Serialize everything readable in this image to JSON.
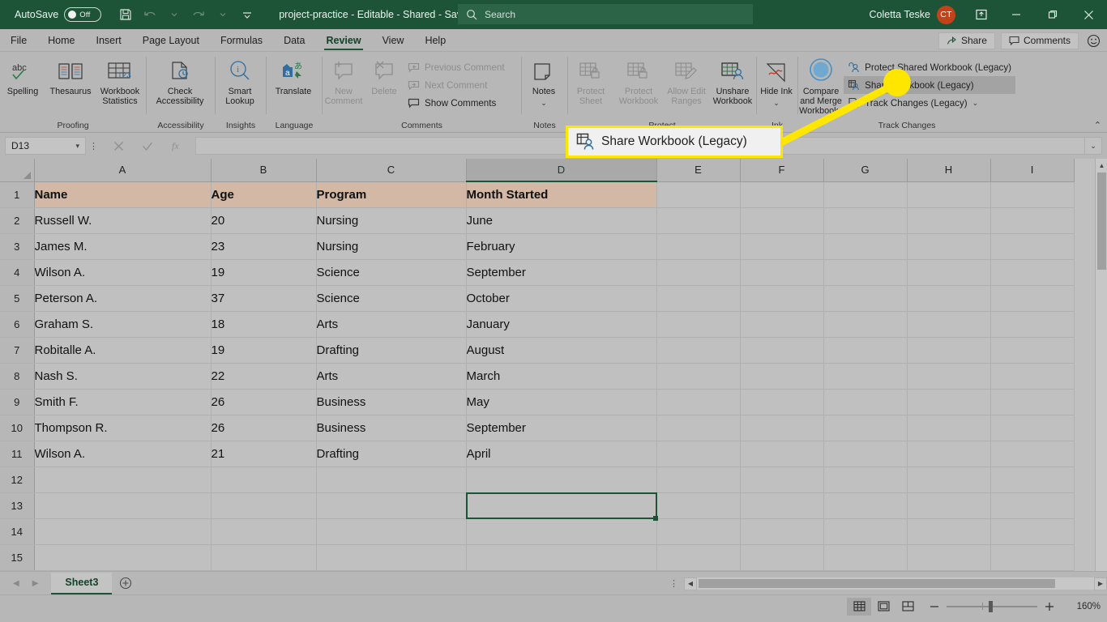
{
  "titlebar": {
    "autosave_label": "AutoSave",
    "autosave_state": "Off",
    "doc_title": "project-practice  -  Editable  -  Shared  -  Saved",
    "search_placeholder": "Search",
    "user_name": "Coletta Teske",
    "avatar_initials": "CT",
    "qat": [
      "save-icon",
      "undo-icon",
      "redo-icon",
      "customize-qat-icon"
    ],
    "window_buttons": [
      "minimize",
      "restore",
      "close"
    ]
  },
  "tabs": {
    "items": [
      {
        "label": "File",
        "active": false
      },
      {
        "label": "Home",
        "active": false
      },
      {
        "label": "Insert",
        "active": false
      },
      {
        "label": "Page Layout",
        "active": false
      },
      {
        "label": "Formulas",
        "active": false
      },
      {
        "label": "Data",
        "active": false
      },
      {
        "label": "Review",
        "active": true
      },
      {
        "label": "View",
        "active": false
      },
      {
        "label": "Help",
        "active": false
      }
    ],
    "share_label": "Share",
    "comments_label": "Comments"
  },
  "ribbon": {
    "groups": [
      {
        "label": "Proofing",
        "buttons": [
          {
            "label": "Spelling",
            "icon": "spelling-abc-check-icon",
            "disabled": false
          },
          {
            "label": "Thesaurus",
            "icon": "thesaurus-book-icon",
            "disabled": false
          },
          {
            "label": "Workbook Statistics",
            "icon": "workbook-statistics-icon",
            "disabled": false
          }
        ]
      },
      {
        "label": "Accessibility",
        "buttons": [
          {
            "label": "Check Accessibility",
            "icon": "check-accessibility-icon",
            "disabled": false
          }
        ]
      },
      {
        "label": "Insights",
        "buttons": [
          {
            "label": "Smart Lookup",
            "icon": "smart-lookup-icon",
            "disabled": false
          }
        ]
      },
      {
        "label": "Language",
        "buttons": [
          {
            "label": "Translate",
            "icon": "translate-icon",
            "disabled": false
          }
        ]
      },
      {
        "label": "Comments",
        "buttons": [
          {
            "label": "New Comment",
            "icon": "new-comment-icon",
            "disabled": true
          },
          {
            "label": "Delete",
            "icon": "delete-comment-icon",
            "disabled": true
          }
        ],
        "small_items": [
          {
            "label": "Previous Comment",
            "icon": "previous-comment-icon",
            "disabled": true
          },
          {
            "label": "Next Comment",
            "icon": "next-comment-icon",
            "disabled": true
          },
          {
            "label": "Show Comments",
            "icon": "show-comments-icon",
            "disabled": false
          }
        ]
      },
      {
        "label": "Notes",
        "buttons": [
          {
            "label": "Notes",
            "icon": "notes-icon",
            "disabled": false,
            "dropdown": true
          }
        ]
      },
      {
        "label": "Protect",
        "buttons": [
          {
            "label": "Protect Sheet",
            "icon": "protect-sheet-icon",
            "disabled": true
          },
          {
            "label": "Protect Workbook",
            "icon": "protect-workbook-icon",
            "disabled": true
          },
          {
            "label": "Allow Edit Ranges",
            "icon": "allow-edit-ranges-icon",
            "disabled": true
          },
          {
            "label": "Unshare Workbook",
            "icon": "unshare-workbook-icon",
            "disabled": false
          }
        ]
      },
      {
        "label": "Ink",
        "buttons": [
          {
            "label": "Hide Ink",
            "icon": "hide-ink-icon",
            "disabled": false,
            "dropdown": true
          }
        ]
      },
      {
        "label": "Track Changes",
        "buttons": [
          {
            "label": "Compare and Merge Workbooks",
            "icon": "compare-merge-workbooks-icon",
            "disabled": false
          }
        ],
        "small_items": [
          {
            "label": "Protect Shared Workbook (Legacy)",
            "icon": "protect-shared-workbook-icon",
            "disabled": false,
            "highlighted": false
          },
          {
            "label": "Share Workbook (Legacy)",
            "icon": "share-workbook-icon",
            "disabled": false,
            "highlighted": true
          },
          {
            "label": "Track Changes (Legacy)",
            "icon": "track-changes-icon",
            "disabled": false,
            "dropdown": true
          }
        ]
      }
    ],
    "collapse_icon": "collapse-ribbon-icon"
  },
  "callout": {
    "text": "Share Workbook (Legacy)",
    "icon": "share-workbook-icon",
    "border_color": "#ffe600",
    "highlight_color": "#ffe600"
  },
  "formulabar": {
    "namebox_value": "D13",
    "cancel_icon": "cancel-icon",
    "enter_icon": "enter-check-icon",
    "function_icon": "insert-function-fx-icon",
    "formula_value": ""
  },
  "grid": {
    "columns": [
      "A",
      "B",
      "C",
      "D",
      "E",
      "F",
      "G",
      "H",
      "I"
    ],
    "selected_column": "D",
    "selected_cell": "D13",
    "rows": [
      {
        "num": "1",
        "cells": [
          "Name",
          "Age",
          "Program",
          "Month Started",
          "",
          "",
          "",
          "",
          ""
        ],
        "header": true
      },
      {
        "num": "2",
        "cells": [
          "Russell W.",
          "20",
          "Nursing",
          "June",
          "",
          "",
          "",
          "",
          ""
        ]
      },
      {
        "num": "3",
        "cells": [
          "James M.",
          "23",
          "Nursing",
          "February",
          "",
          "",
          "",
          "",
          ""
        ]
      },
      {
        "num": "4",
        "cells": [
          "Wilson A.",
          "19",
          "Science",
          "September",
          "",
          "",
          "",
          "",
          ""
        ]
      },
      {
        "num": "5",
        "cells": [
          "Peterson A.",
          "37",
          "Science",
          "October",
          "",
          "",
          "",
          "",
          ""
        ]
      },
      {
        "num": "6",
        "cells": [
          "Graham S.",
          "18",
          "Arts",
          "January",
          "",
          "",
          "",
          "",
          ""
        ]
      },
      {
        "num": "7",
        "cells": [
          "Robitalle A.",
          "19",
          "Drafting",
          "August",
          "",
          "",
          "",
          "",
          ""
        ]
      },
      {
        "num": "8",
        "cells": [
          "Nash S.",
          "22",
          "Arts",
          "March",
          "",
          "",
          "",
          "",
          ""
        ]
      },
      {
        "num": "9",
        "cells": [
          "Smith F.",
          "26",
          "Business",
          "May",
          "",
          "",
          "",
          "",
          ""
        ]
      },
      {
        "num": "10",
        "cells": [
          "Thompson R.",
          "26",
          "Business",
          "September",
          "",
          "",
          "",
          "",
          ""
        ]
      },
      {
        "num": "11",
        "cells": [
          "Wilson A.",
          "21",
          "Drafting",
          "April",
          "",
          "",
          "",
          "",
          ""
        ]
      },
      {
        "num": "12",
        "cells": [
          "",
          "",
          "",
          "",
          "",
          "",
          "",
          "",
          ""
        ]
      },
      {
        "num": "13",
        "cells": [
          "",
          "",
          "",
          "",
          "",
          "",
          "",
          "",
          ""
        ]
      },
      {
        "num": "14",
        "cells": [
          "",
          "",
          "",
          "",
          "",
          "",
          "",
          "",
          ""
        ]
      },
      {
        "num": "15",
        "cells": [
          "",
          "",
          "",
          "",
          "",
          "",
          "",
          "",
          ""
        ]
      }
    ],
    "header_fill": "#d3b9a5"
  },
  "sheetbar": {
    "sheets": [
      {
        "label": "Sheet3",
        "active": true
      }
    ],
    "add_sheet_icon": "add-sheet-plus-icon"
  },
  "statusbar": {
    "view_buttons": [
      {
        "icon": "normal-view-icon",
        "active": true
      },
      {
        "icon": "page-layout-view-icon",
        "active": false
      },
      {
        "icon": "page-break-preview-icon",
        "active": false
      }
    ],
    "zoom_out_icon": "zoom-out-minus-icon",
    "zoom_in_icon": "zoom-in-plus-icon",
    "zoom_level": "160%"
  }
}
